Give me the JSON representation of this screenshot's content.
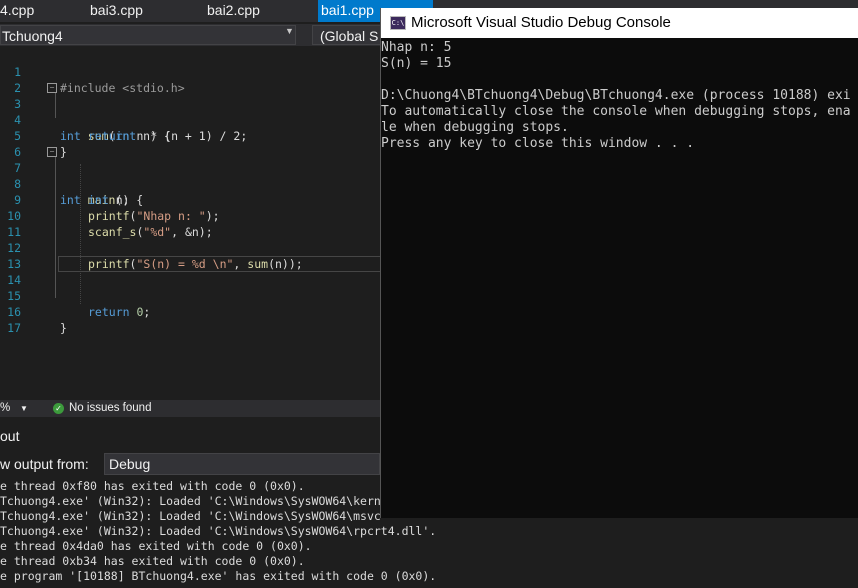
{
  "tabs": [
    {
      "label": "4.cpp",
      "active": false
    },
    {
      "label": "bai3.cpp",
      "active": false
    },
    {
      "label": "bai2.cpp",
      "active": false
    },
    {
      "label": "bai1.cpp",
      "active": true
    }
  ],
  "nav": {
    "project": "Tchuong4",
    "scope": "(Global S"
  },
  "editor": {
    "line_numbers": [
      "1",
      "2",
      "3",
      "4",
      "5",
      "6",
      "7",
      "8",
      "9",
      "10",
      "11",
      "12",
      "13",
      "14",
      "15",
      "16",
      "17"
    ],
    "code": {
      "l1": "#include <stdio.h>",
      "l3_kw": "int",
      "l3_fn": "sum",
      "l3_open": "(",
      "l3_kw2": "int",
      "l3_rest": " n) {",
      "l4_kw": "return",
      "l4_rest": " n * (n + 1) / 2;",
      "l5": "}",
      "l7_kw": "int",
      "l7_fn": "main",
      "l7_rest": "() {",
      "l8_kw": "int",
      "l8_rest": " n;",
      "l9_fn": "printf",
      "l9_open": "(",
      "l9_str": "\"Nhap n: \"",
      "l9_close": ");",
      "l10_fn": "scanf_s",
      "l10_open": "(",
      "l10_str": "\"%d\"",
      "l10_close": ", &n);",
      "l12_fn": "printf",
      "l12_open": "(",
      "l12_str": "\"S(n) = %d \\n\"",
      "l12_mid": ", ",
      "l12_fn2": "sum",
      "l12_close": "(n));",
      "l15_kw": "return",
      "l15_num": " 0",
      "l15_close": ";",
      "l16": "}"
    }
  },
  "status": {
    "zoom": "%",
    "issues": "No issues found"
  },
  "output": {
    "title": "out",
    "show_from_label": "w output from:",
    "source": "Debug",
    "lines": [
      "e thread 0xf80 has exited with code 0 (0x0).",
      "Tchuong4.exe' (Win32): Loaded 'C:\\Windows\\SysWOW64\\kern",
      "Tchuong4.exe' (Win32): Loaded 'C:\\Windows\\SysWOW64\\msvc",
      "Tchuong4.exe' (Win32): Loaded 'C:\\Windows\\SysWOW64\\rpcrt4.dll'.",
      "e thread 0x4da0 has exited with code 0 (0x0).",
      "e thread 0xb34 has exited with code 0 (0x0).",
      "e program '[10188] BTchuong4.exe' has exited with code 0 (0x0)."
    ]
  },
  "console": {
    "title": "Microsoft Visual Studio Debug Console",
    "icon_text": "C:\\",
    "lines": [
      "Nhap n: 5",
      "S(n) = 15",
      "",
      "D:\\Chuong4\\BTchuong4\\Debug\\BTchuong4.exe (process 10188) exi",
      "To automatically close the console when debugging stops, ena",
      "le when debugging stops.",
      "Press any key to close this window . . ."
    ]
  },
  "colors": {
    "accent": "#007acc",
    "keyword": "#569cd6",
    "function": "#dcdcaa",
    "string": "#d69d85",
    "ok_green": "#3c9a3c"
  }
}
